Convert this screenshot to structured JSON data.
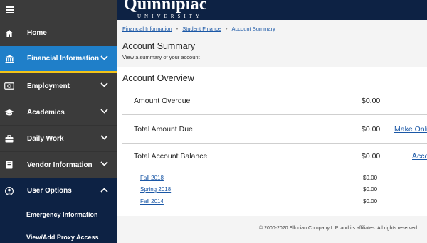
{
  "sidebar": {
    "items": [
      {
        "label": "Home",
        "icon": "home-icon"
      },
      {
        "label": "Financial Information",
        "icon": "bank-icon"
      },
      {
        "label": "Employment",
        "icon": "money-icon"
      },
      {
        "label": "Academics",
        "icon": "graduation-cap-icon"
      },
      {
        "label": "Daily Work",
        "icon": "briefcase-icon"
      },
      {
        "label": "Vendor Information",
        "icon": "book-icon"
      },
      {
        "label": "User Options",
        "icon": "user-icon"
      }
    ],
    "sub_items": [
      "Emergency Information",
      "View/Add Proxy Access"
    ]
  },
  "header": {
    "logo_title": "Quinnipiac",
    "logo_subtitle": "UNIVERSITY"
  },
  "breadcrumb": [
    "Financial Information",
    "Student Finance",
    "Account Summary"
  ],
  "page": {
    "title": "Account Summary",
    "subtitle": "View a summary of your account"
  },
  "overview": {
    "title": "Account Overview",
    "rows": [
      {
        "label": "Amount Overdue",
        "amount": "$0.00"
      },
      {
        "label": "Total Amount Due",
        "amount": "$0.00",
        "link": "Make Onli"
      },
      {
        "label": "Total Account Balance",
        "amount": "$0.00",
        "link": "Acco"
      }
    ],
    "terms": [
      {
        "label": "Fall 2018",
        "amount": "$0.00"
      },
      {
        "label": "Spring 2018",
        "amount": "$0.00"
      },
      {
        "label": "Fall 2014",
        "amount": "$0.00"
      }
    ]
  },
  "footer": {
    "text": "© 2000-2020 Ellucian Company L.P. and its affiliates. All rights reserved"
  },
  "colors": {
    "sidebar_bg": "#3b3b3b",
    "navy": "#0d2244",
    "active_blue": "#1f7fc9",
    "active_underline": "#f2c318",
    "link_blue": "#1a57a6"
  }
}
